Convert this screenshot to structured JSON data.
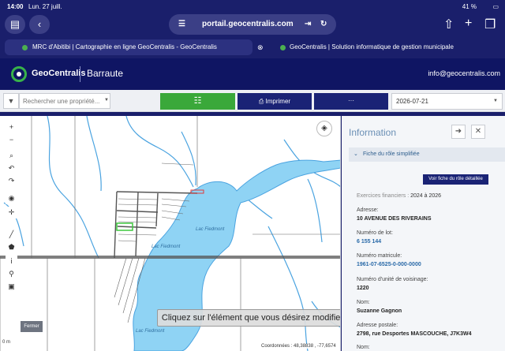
{
  "status_bar": {
    "time": "14:00",
    "date": "Lun. 27 juill.",
    "battery": "41 %"
  },
  "browser": {
    "url": "portail.geocentralis.com",
    "tabs": [
      {
        "label": "MRC d'Abitibi | Cartographie en ligne GeoCentralis - GeoCentralis"
      },
      {
        "label": "GeoCentralis | Solution informatique de gestion municipale"
      }
    ]
  },
  "header": {
    "brand": "GeoCentralis",
    "city": "Barraute",
    "email": "info@geocentralis.com"
  },
  "toolbar": {
    "search_placeholder": "Rechercher une propriété...",
    "print_label": "Imprimer",
    "more_label": "···",
    "date": "2026-07-21"
  },
  "map": {
    "lake_labels": [
      "Lac Fiedmont",
      "Lac Fiedmont",
      "Lac Fiedmont"
    ],
    "tooltip": "Cliquez sur l'élément que vous désirez modifier",
    "close_label": "Fermer",
    "coords": "Coordonnées : 48,38838 , -77,6574",
    "scale": "0 m"
  },
  "panel": {
    "title": "Information",
    "section": "Fiche du rôle simplifiée",
    "detail_button": "Voir fiche du rôle détaillée",
    "fiscal_label": "Exercices financiers :",
    "fiscal_value": "2024 à 2026",
    "fields": [
      {
        "label": "Adresse:",
        "value": "10 AVENUE DES RIVERAINS",
        "link": false
      },
      {
        "label": "Numéro de lot:",
        "value": "6 155 144",
        "link": true
      },
      {
        "label": "Numéro matricule:",
        "value": "1961-07-6525-0-000-0000",
        "link": true
      },
      {
        "label": "Numéro d'unité de voisinage:",
        "value": "1220",
        "link": false
      },
      {
        "label": "Nom:",
        "value": "Suzanne Gagnon",
        "link": false
      },
      {
        "label": "Adresse postale:",
        "value": "2798, rue Desportes MASCOUCHE, J7K3W4",
        "link": false
      },
      {
        "label": "Nom:",
        "value": "",
        "link": false
      }
    ]
  },
  "colors": {
    "header_bg": "#0f1563",
    "accent_green": "#3aa83a",
    "lake": "#8fd3f4",
    "river": "#4aa3e0"
  }
}
